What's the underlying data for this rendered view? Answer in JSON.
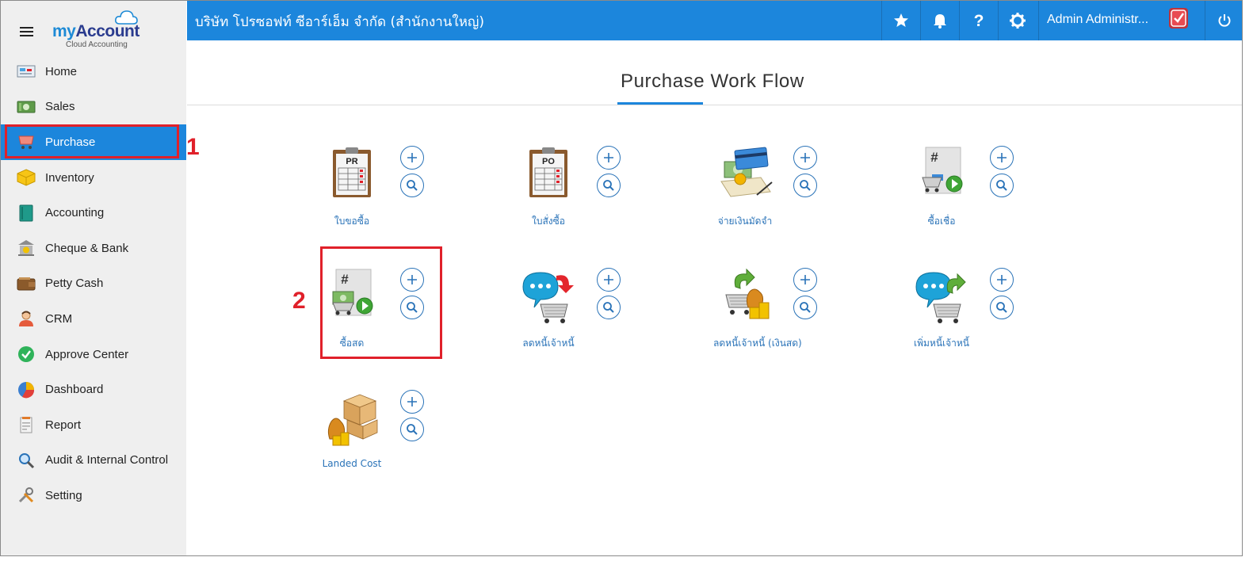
{
  "brand": {
    "name_part1": "my",
    "name_part2": "Account",
    "tagline": "Cloud Accounting"
  },
  "sidebar": {
    "items": [
      {
        "label": "Home",
        "icon": "home-icon"
      },
      {
        "label": "Sales",
        "icon": "sales-icon"
      },
      {
        "label": "Purchase",
        "icon": "purchase-cart-icon",
        "active": true
      },
      {
        "label": "Inventory",
        "icon": "inventory-box-icon"
      },
      {
        "label": "Accounting",
        "icon": "accounting-book-icon"
      },
      {
        "label": "Cheque & Bank",
        "icon": "bank-icon"
      },
      {
        "label": "Petty Cash",
        "icon": "wallet-icon"
      },
      {
        "label": "CRM",
        "icon": "crm-person-icon"
      },
      {
        "label": "Approve Center",
        "icon": "check-circle-icon"
      },
      {
        "label": "Dashboard",
        "icon": "pie-chart-icon"
      },
      {
        "label": "Report",
        "icon": "report-icon"
      },
      {
        "label": "Audit & Internal Control",
        "icon": "magnifier-icon"
      },
      {
        "label": "Setting",
        "icon": "tools-icon"
      }
    ]
  },
  "topbar": {
    "company": "บริษัท โปรซอฟท์ ซีอาร์เอ็ม จำกัด (สำนักงานใหญ่)",
    "user_name": "Admin Administr...",
    "icons": [
      "star-icon",
      "bell-icon",
      "help-icon",
      "gear-icon",
      "power-icon"
    ]
  },
  "main": {
    "title": "Purchase Work Flow",
    "tiles": [
      {
        "label": "ใบขอซื้อ",
        "icon": "purchase-request-clipboard-icon",
        "badge": "PR"
      },
      {
        "label": "ใบสั่งซื้อ",
        "icon": "purchase-order-clipboard-icon",
        "badge": "PO"
      },
      {
        "label": "จ่ายเงินมัดจำ",
        "icon": "deposit-payment-icon"
      },
      {
        "label": "ซื้อเชื่อ",
        "icon": "credit-purchase-icon",
        "badge": "#"
      },
      {
        "label": "ซื้อสด",
        "icon": "cash-purchase-icon",
        "badge": "#"
      },
      {
        "label": "ลดหนี้เจ้าหนี้",
        "icon": "creditor-debit-note-icon"
      },
      {
        "label": "ลดหนี้เจ้าหนี้ (เงินสด)",
        "icon": "creditor-cash-debit-note-icon"
      },
      {
        "label": "เพิ่มหนี้เจ้าหนี้",
        "icon": "creditor-credit-note-icon"
      },
      {
        "label": "Landed Cost",
        "icon": "landed-cost-icon"
      }
    ]
  },
  "annotations": {
    "step1": "1",
    "step2": "2"
  },
  "colors": {
    "primary": "#1c86dc",
    "callout": "#e0202a",
    "link": "#2a73b8",
    "sidebar_bg": "#efefef"
  }
}
